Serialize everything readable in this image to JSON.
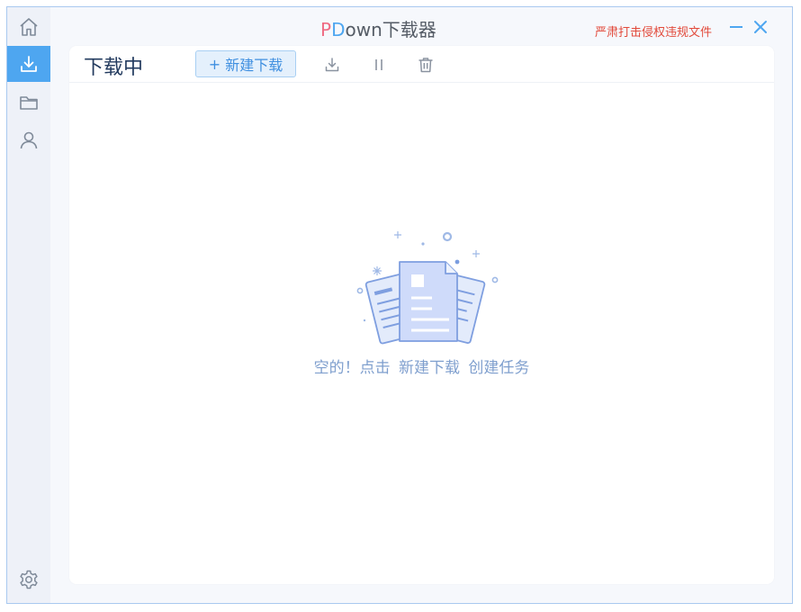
{
  "window": {
    "title_p": "P",
    "title_d": "D",
    "title_rest": "own下载器",
    "notice": "严肃打击侵权违规文件"
  },
  "sidebar": {
    "items": [
      {
        "icon": "home-icon",
        "active": false
      },
      {
        "icon": "download-icon",
        "active": true
      },
      {
        "icon": "folder-icon",
        "active": false
      },
      {
        "icon": "user-icon",
        "active": false
      }
    ],
    "bottom": {
      "icon": "gear-icon"
    }
  },
  "header": {
    "title": "下载中",
    "new_button_plus": "+",
    "new_button_label": "新建下载",
    "tools": [
      "download-icon",
      "pause-icon",
      "trash-icon"
    ]
  },
  "empty": {
    "part1": "空的！点击",
    "part2": "新建下载",
    "part3": "创建任务"
  },
  "colors": {
    "accent": "#4ea6f0",
    "notice": "#e24a3b",
    "title_p": "#ef6b83",
    "empty_text": "#7f9fce"
  }
}
